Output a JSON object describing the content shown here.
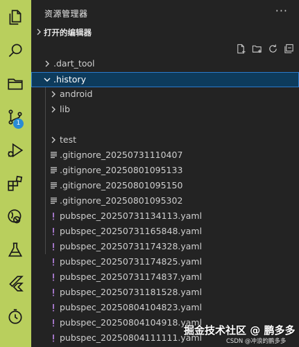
{
  "activity_bar": {
    "badge_count": "1",
    "icons": [
      "files-icon",
      "search-icon",
      "folder-icon",
      "source-control-icon",
      "run-debug-icon",
      "extensions-icon",
      "remote-explorer-icon",
      "testing-icon",
      "flutter-icon",
      "timeline-icon"
    ]
  },
  "explorer": {
    "title": "资源管理器",
    "more_label": "···",
    "open_editors_label": "打开的编辑器"
  },
  "tree": [
    {
      "label": ".dart_tool",
      "kind": "folder",
      "expanded": false
    },
    {
      "label": ".history",
      "kind": "folder",
      "expanded": true,
      "selected": true
    },
    {
      "label": "android",
      "kind": "folder",
      "expanded": false
    },
    {
      "label": "lib",
      "kind": "folder",
      "expanded": false
    },
    {
      "label": "",
      "kind": "blank"
    },
    {
      "label": "test",
      "kind": "folder",
      "expanded": false
    },
    {
      "label": ".gitignore_20250731110407",
      "kind": "gitignore"
    },
    {
      "label": ".gitignore_20250801095133",
      "kind": "gitignore"
    },
    {
      "label": ".gitignore_20250801095150",
      "kind": "gitignore"
    },
    {
      "label": ".gitignore_20250801095302",
      "kind": "gitignore"
    },
    {
      "label": "pubspec_20250731134113.yaml",
      "kind": "yaml"
    },
    {
      "label": "pubspec_20250731165848.yaml",
      "kind": "yaml"
    },
    {
      "label": "pubspec_20250731174328.yaml",
      "kind": "yaml"
    },
    {
      "label": "pubspec_20250731174825.yaml",
      "kind": "yaml"
    },
    {
      "label": "pubspec_20250731174837.yaml",
      "kind": "yaml"
    },
    {
      "label": "pubspec_20250731181528.yaml",
      "kind": "yaml"
    },
    {
      "label": "pubspec_20250804104823.yaml",
      "kind": "yaml"
    },
    {
      "label": "pubspec_20250804104918.yaml",
      "kind": "yaml"
    },
    {
      "label": "pubspec_20250804111111.yaml",
      "kind": "yaml"
    }
  ],
  "watermark": {
    "main": "掘金技术社区 @ 鹏多多",
    "sub": "CSDN @冲浪的鹏多多"
  },
  "colors": {
    "activity_bar": "#b9cf5d",
    "sidebar_bg": "#232323",
    "selected_bg": "#0d3b5c",
    "yaml_icon": "#a074c4",
    "badge": "#2a8bd4"
  }
}
